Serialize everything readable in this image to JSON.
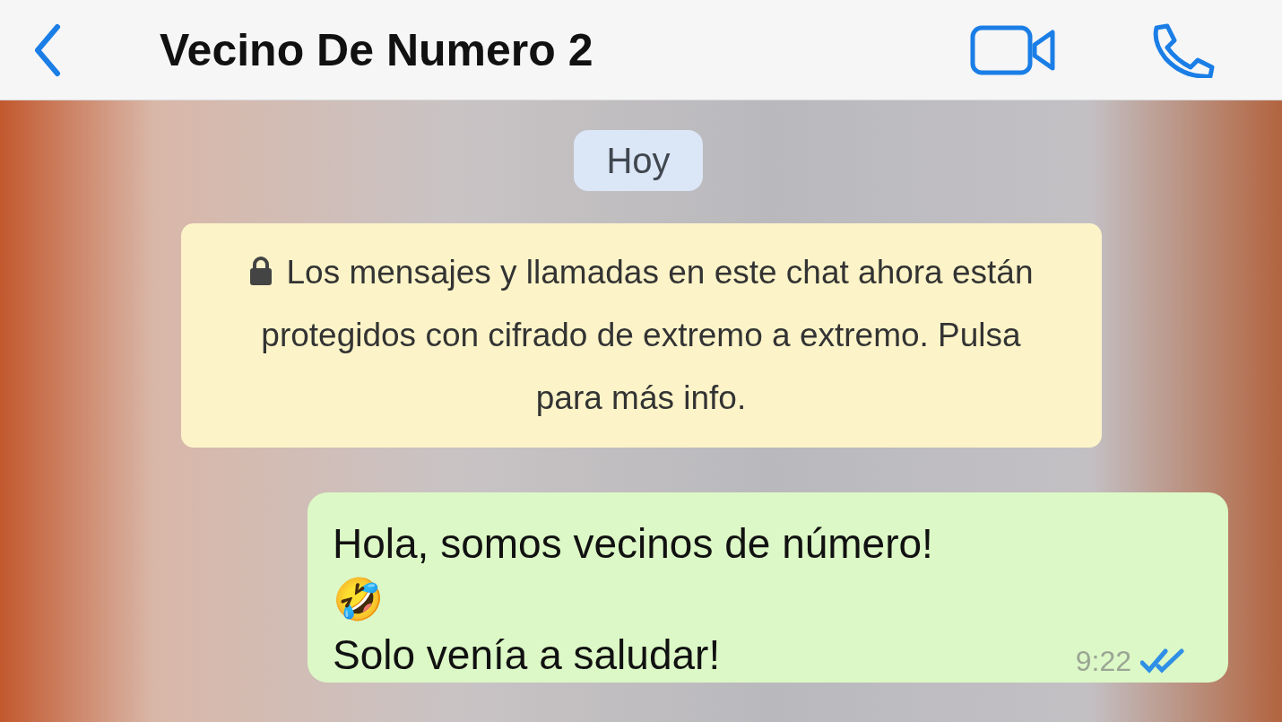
{
  "header": {
    "title": "Vecino De Numero 2"
  },
  "date_chip": "Hoy",
  "notice": {
    "text": "Los mensajes y llamadas en este chat ahora están protegidos con cifrado de extremo a extremo. Pulsa para más info."
  },
  "messages": [
    {
      "kind": "outgoing",
      "text": "Hola, somos vecinos de número!\n🤣\nSolo venía a saludar!",
      "time": "9:22",
      "read": true
    }
  ]
}
